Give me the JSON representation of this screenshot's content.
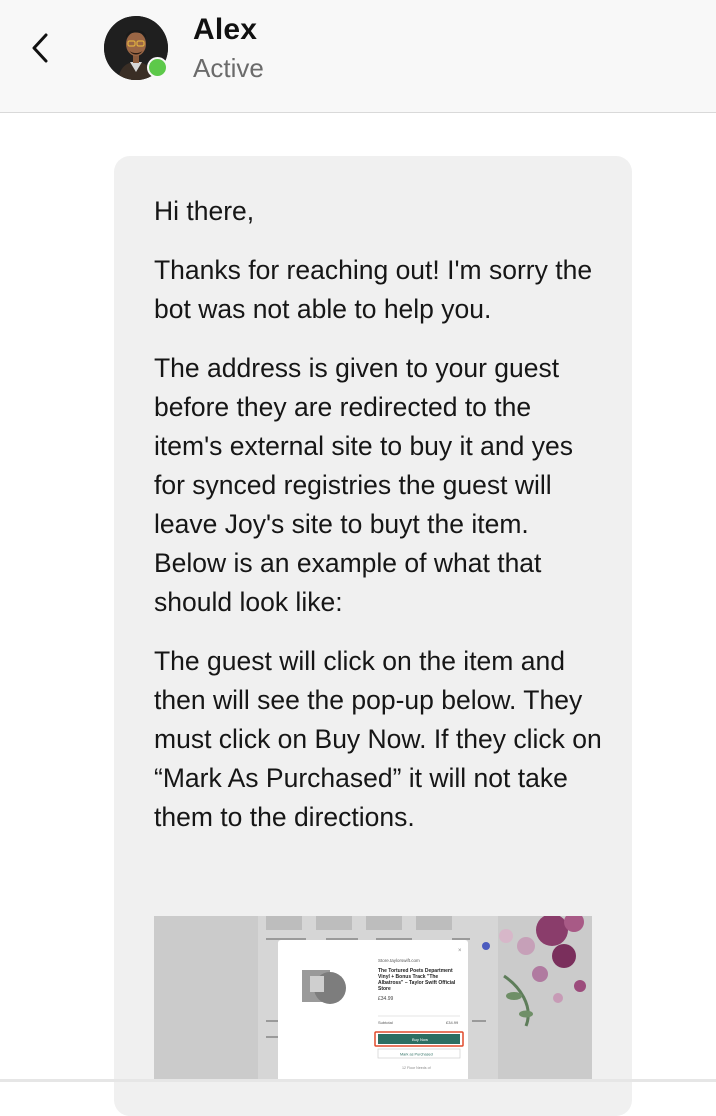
{
  "header": {
    "name": "Alex",
    "status": "Active",
    "presence_color": "#5dc94a"
  },
  "message": {
    "paragraphs": [
      "Hi there,",
      "Thanks for reaching out! I'm sorry the bot was not able to help you.",
      "The address is given to your guest before they are redirected to the item's external site to buy it and yes for synced registries the guest will leave Joy's site to buyt the item. Below is an example of what that should look like:",
      "The guest will click on the item and then will see the pop-up below. They must click on Buy Now. If they click on “Mark As Purchased” it will not take them to the directions."
    ]
  },
  "screenshot": {
    "store": "Store.taylorswift.com",
    "product_title": "The Tortured Poets Department Vinyl + Bonus Track \"The Albatross\" – Taylor Swift Official Store",
    "price": "£34.99",
    "subtotal_label": "Subtotal",
    "subtotal_value": "£34.99",
    "buy_label": "Buy Now",
    "mark_label": "Mark as Purchased",
    "remaining_label": "12 Floor Needs of",
    "highlight_color": "#e04a2b",
    "button_color": "#2c6e62"
  }
}
